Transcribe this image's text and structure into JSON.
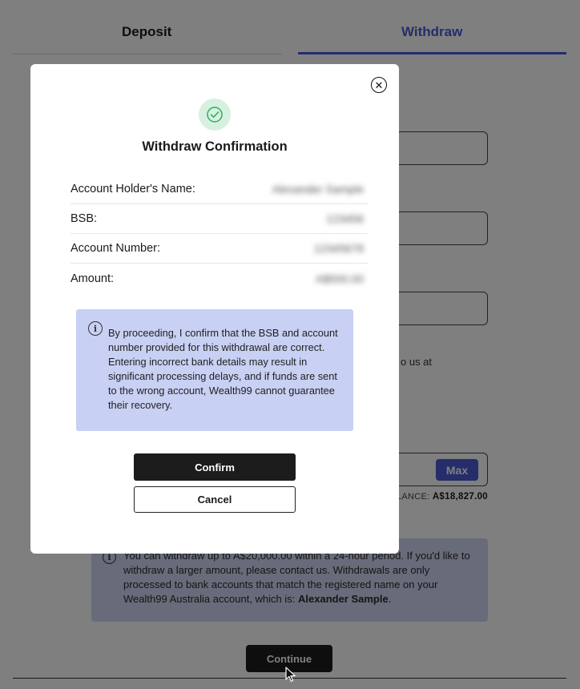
{
  "tabs": {
    "deposit": "Deposit",
    "withdraw": "Withdraw"
  },
  "form": {
    "max_label": "Max",
    "contact_fragment": "o us at",
    "balance_label": "ALANCE:",
    "balance_value": "A$18,827.00"
  },
  "info": {
    "text_before": "You can withdraw up to A$20,000.00 within a 24-hour period. If you'd like to withdraw a larger amount, please contact us. Withdrawals are only processed to bank accounts that match the registered name on your Wealth99 Australia account, which is: ",
    "account_name": "Alexander Sample",
    "text_after": "."
  },
  "continue_label": "Continue",
  "modal": {
    "title": "Withdraw Confirmation",
    "details": [
      {
        "label": "Account Holder's Name:",
        "value": "Alexander Sample"
      },
      {
        "label": "BSB:",
        "value": "123456"
      },
      {
        "label": "Account Number:",
        "value": "12345678"
      },
      {
        "label": "Amount:",
        "value": "A$500.00"
      }
    ],
    "notice": "By proceeding, I confirm that the BSB and account number provided for this withdrawal are correct. Entering incorrect bank details may result in significant processing delays, and if funds are sent to the wrong account, Wealth99 cannot guarantee their recovery.",
    "confirm_label": "Confirm",
    "cancel_label": "Cancel"
  },
  "colors": {
    "accent": "#4a5bd4",
    "notice_bg": "#c8d0f3",
    "success": "#d6f1e0"
  }
}
